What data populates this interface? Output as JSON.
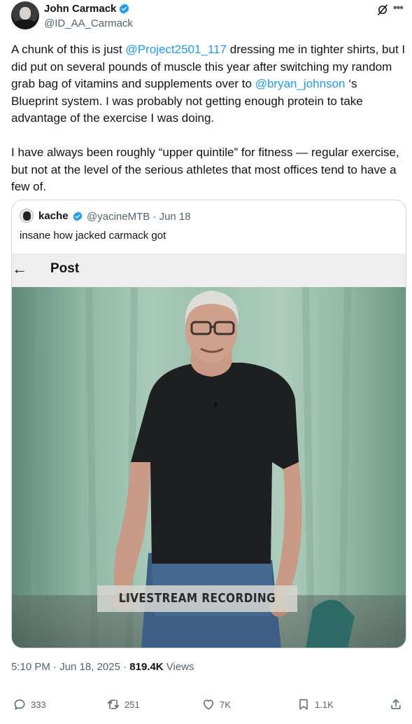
{
  "author": {
    "name": "John Carmack",
    "handle": "@ID_AA_Carmack"
  },
  "tweet": {
    "paragraphs": [
      [
        {
          "text": "A chunk of this is just "
        },
        {
          "text": "@Project2501_117",
          "mention": true
        },
        {
          "text": " dressing me in tighter shirts, but I did put on several pounds of muscle this year after switching my random grab bag of vitamins and supplements over to "
        },
        {
          "text": "@bryan_johnson",
          "mention": true
        },
        {
          "text": " ‘s Blueprint system. I was probably not getting enough protein to take advantage of the exercise I was doing."
        }
      ],
      [
        {
          "text": "I have always been roughly “upper quintile” for fitness — regular exercise, but not at the level of the serious athletes that most offices tend to have a few of."
        }
      ]
    ]
  },
  "quote": {
    "name": "kache",
    "handle_date": "@yacineMTB · Jun 18",
    "text": "insane how jacked carmack got",
    "inner_title": "Post",
    "banner": "LIVESTREAM RECORDING"
  },
  "meta": {
    "time_date": "5:10 PM · Jun 18, 2025 · ",
    "views_count": "819.4K",
    "views_label": " Views"
  },
  "actions": {
    "replies": "333",
    "reposts": "251",
    "likes": "7K",
    "bookmarks": "1.1K"
  },
  "icons": [
    "verified-badge-icon",
    "grok-icon",
    "more-icon",
    "back-arrow-icon",
    "reply-icon",
    "repost-icon",
    "like-icon",
    "bookmark-icon",
    "share-icon"
  ],
  "colors": {
    "accent": "#1d9bf0",
    "text": "#0f1419",
    "secondary": "#536471",
    "border": "#cfd9de"
  }
}
